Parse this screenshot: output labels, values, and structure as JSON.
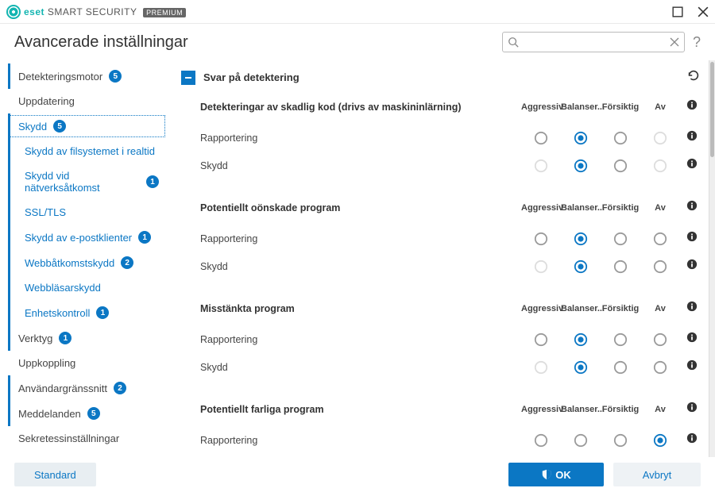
{
  "brand": {
    "eset": "eset",
    "product": "SMART SECURITY",
    "badge": "PREMIUM"
  },
  "page_title": "Avancerade inställningar",
  "search": {
    "placeholder": ""
  },
  "sidebar": [
    {
      "label": "Detekteringsmotor",
      "badge": "5",
      "top": true,
      "bar": true
    },
    {
      "label": "Uppdatering",
      "top": true
    },
    {
      "label": "Skydd",
      "badge": "5",
      "top": true,
      "bar": true,
      "blue": true,
      "selected": true
    },
    {
      "label": "Skydd av filsystemet i realtid",
      "sub": true,
      "bar": true,
      "blue": true
    },
    {
      "label": "Skydd vid nätverksåtkomst",
      "badge": "1",
      "sub": true,
      "bar": true,
      "blue": true
    },
    {
      "label": "SSL/TLS",
      "sub": true,
      "bar": true,
      "blue": true
    },
    {
      "label": "Skydd av e-postklienter",
      "badge": "1",
      "sub": true,
      "bar": true,
      "blue": true
    },
    {
      "label": "Webbåtkomstskydd",
      "badge": "2",
      "sub": true,
      "bar": true,
      "blue": true
    },
    {
      "label": "Webbläsarskydd",
      "sub": true,
      "bar": true,
      "blue": true
    },
    {
      "label": "Enhetskontroll",
      "badge": "1",
      "sub": true,
      "bar": true,
      "blue": true
    },
    {
      "label": "Verktyg",
      "badge": "1",
      "top": true,
      "bar": true
    },
    {
      "label": "Uppkoppling",
      "top": true
    },
    {
      "label": "Användargränssnitt",
      "badge": "2",
      "top": true,
      "bar": true
    },
    {
      "label": "Meddelanden",
      "badge": "5",
      "top": true,
      "bar": true
    },
    {
      "label": "Sekretessinställningar",
      "top": true
    }
  ],
  "section_title": "Svar på detektering",
  "columns": [
    "Aggressiv",
    "Balanser...",
    "Försiktig",
    "Av"
  ],
  "groups": [
    {
      "title": "Detekteringar av skadlig kod (drivs av maskininlärning)",
      "rows": [
        {
          "label": "Rapportering",
          "selected": 1,
          "disabled": [
            3
          ]
        },
        {
          "label": "Skydd",
          "selected": 1,
          "disabled": [
            0,
            3
          ]
        }
      ]
    },
    {
      "title": "Potentiellt oönskade program",
      "rows": [
        {
          "label": "Rapportering",
          "selected": 1
        },
        {
          "label": "Skydd",
          "selected": 1,
          "disabled": [
            0
          ]
        }
      ]
    },
    {
      "title": "Misstänkta program",
      "rows": [
        {
          "label": "Rapportering",
          "selected": 1
        },
        {
          "label": "Skydd",
          "selected": 1,
          "disabled": [
            0
          ]
        }
      ]
    },
    {
      "title": "Potentiellt farliga program",
      "rows": [
        {
          "label": "Rapportering",
          "selected": 3
        }
      ]
    }
  ],
  "footer": {
    "default": "Standard",
    "ok": "OK",
    "cancel": "Avbryt"
  }
}
